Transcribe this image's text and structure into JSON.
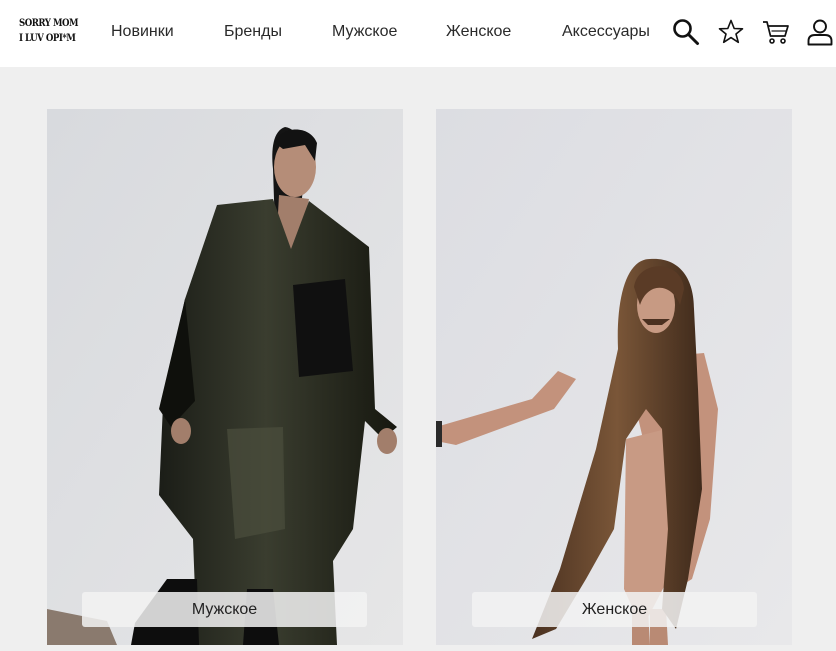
{
  "brand": {
    "logo_line1": "SORRY MOM",
    "logo_line2": "I LUV OPI*M"
  },
  "nav": [
    {
      "label": "Новинки"
    },
    {
      "label": "Бренды"
    },
    {
      "label": "Мужское"
    },
    {
      "label": "Женское"
    },
    {
      "label": "Аксессуары"
    }
  ],
  "header_icons": [
    "search-icon",
    "star-icon",
    "cart-icon",
    "user-icon"
  ],
  "categories": [
    {
      "label": "Мужское"
    },
    {
      "label": "Женское"
    }
  ],
  "colors": {
    "header_bg": "#ffffff",
    "page_bg": "#efefef",
    "label_bg": "#f2f2f2",
    "text": "#222222"
  }
}
